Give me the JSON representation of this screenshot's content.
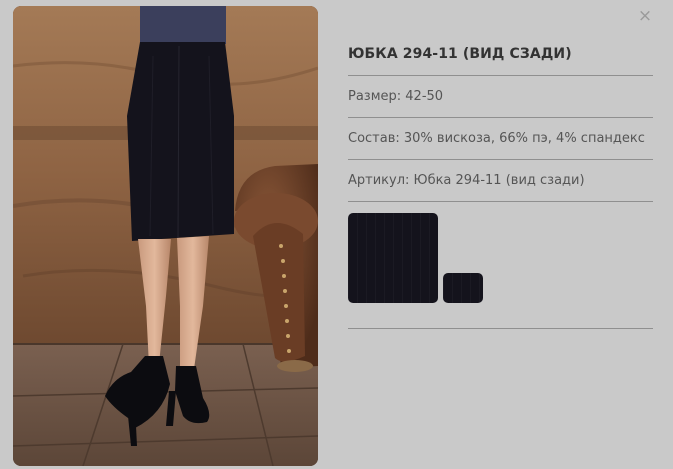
{
  "close": {
    "icon": "close-icon",
    "glyph": "×"
  },
  "product": {
    "title": "ЮБКА 294-11 (ВИД СЗАДИ)",
    "size_text": "Размер: 42-50",
    "composition_text": "Состав: 30% вискоза, 66% пэ, 4% спандекс",
    "sku_text": "Артикул: Юбка 294-11 (вид сзади)"
  },
  "swatches": [
    {
      "name": "swatch-large",
      "color": "#14131c"
    },
    {
      "name": "swatch-small",
      "color": "#14131c"
    }
  ],
  "colors": {
    "background": "#c9c9c9",
    "text": "#555555",
    "title": "#333333",
    "divider": "#8f8f8f"
  }
}
